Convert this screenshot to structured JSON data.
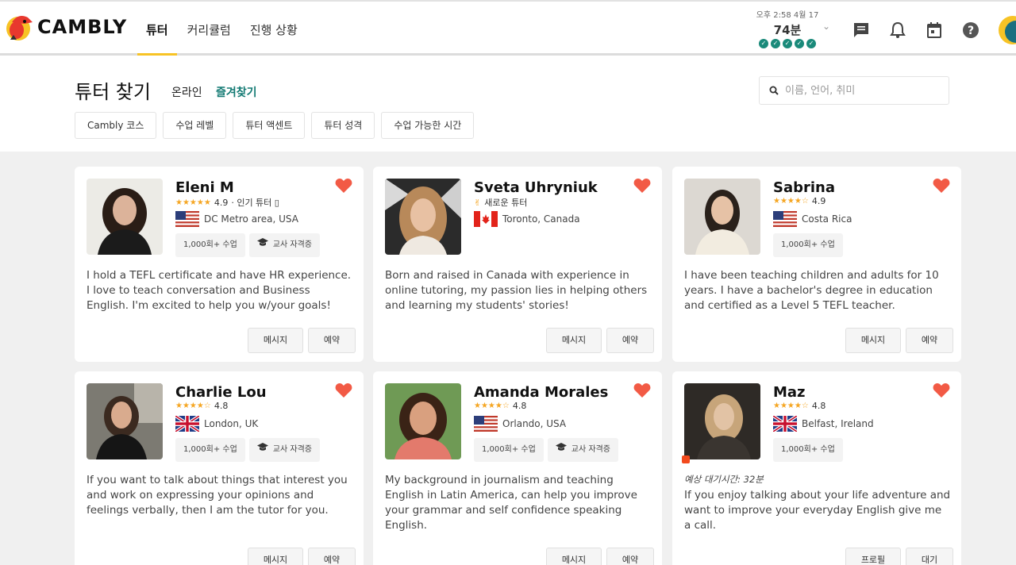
{
  "header": {
    "logo_text": "CAMBLY",
    "nav": [
      {
        "label": "튜터",
        "active": true
      },
      {
        "label": "커리큘럼",
        "active": false
      },
      {
        "label": "진행 상황",
        "active": false
      }
    ],
    "minutes": {
      "date": "오후 2:58 4월 17",
      "value": "74분",
      "completed_checks": 5
    },
    "icons": [
      "chat-icon",
      "bell-icon",
      "calendar-icon",
      "help-icon"
    ]
  },
  "filters": {
    "title": "튜터 찾기",
    "tabs": {
      "online": "온라인",
      "favorites": "즐겨찾기"
    },
    "search_placeholder": "이름, 언어, 취미",
    "chips": [
      "Cambly 코스",
      "수업 레벨",
      "튜터 액센트",
      "튜터 성격",
      "수업 가능한 시간"
    ]
  },
  "tutors": [
    {
      "name": "Eleni M",
      "rating": "4.9",
      "stars": "★★★★★",
      "extra": "· 인기 튜터 ▯",
      "location": "DC Metro area, USA",
      "flag": "us",
      "tags": [
        "1,000회+ 수업",
        "교사 자격증"
      ],
      "bio": "I hold a TEFL certificate and have HR experience. I love to teach conversation and Business English. I'm excited to help you w/your goals!",
      "buttons": [
        "메시지",
        "예약"
      ]
    },
    {
      "name": "Sveta Uhryniuk",
      "new_label": "새로운 튜터",
      "location": "Toronto, Canada",
      "flag": "ca",
      "tags": [],
      "bio": "Born and raised in Canada with experience in online tutoring, my passion lies in helping others and learning my students' stories!",
      "buttons": [
        "메시지",
        "예약"
      ]
    },
    {
      "name": "Sabrina",
      "rating": "4.9",
      "stars": "★★★★☆",
      "location": "Costa Rica",
      "flag": "us",
      "tags": [
        "1,000회+ 수업"
      ],
      "bio": "I have been teaching children and adults for 10 years. I have a bachelor's degree in education and certified as a Level 5 TEFL teacher.",
      "buttons": [
        "메시지",
        "예약"
      ]
    },
    {
      "name": "Charlie Lou",
      "rating": "4.8",
      "stars": "★★★★☆",
      "location": "London, UK",
      "flag": "uk",
      "tags": [
        "1,000회+ 수업",
        "교사 자격증"
      ],
      "bio": "If you want to talk about things that interest you and work on expressing your opinions and feelings verbally, then I am the tutor for you.",
      "buttons": [
        "메시지",
        "예약"
      ]
    },
    {
      "name": "Amanda Morales",
      "rating": "4.8",
      "stars": "★★★★☆",
      "location": "Orlando, USA",
      "flag": "us",
      "tags": [
        "1,000회+ 수업",
        "교사 자격증"
      ],
      "bio": "My background in journalism and teaching English in Latin America, can help you improve your grammar and self confidence speaking English.",
      "buttons": [
        "메시지",
        "예약"
      ]
    },
    {
      "name": "Maz",
      "rating": "4.8",
      "stars": "★★★★☆",
      "location": "Belfast, Ireland",
      "flag": "uk",
      "tags": [
        "1,000회+ 수업"
      ],
      "wait_time": "예상 대기시간: 32분",
      "bio": "If you enjoy talking about your life adventure and want to improve your everyday English give me a call.",
      "buttons": [
        "프로필",
        "대기"
      ]
    }
  ],
  "colors": {
    "accent_yellow": "#f7c325",
    "teal": "#137a73",
    "heart": "#f25a45",
    "star": "#f5a623"
  }
}
